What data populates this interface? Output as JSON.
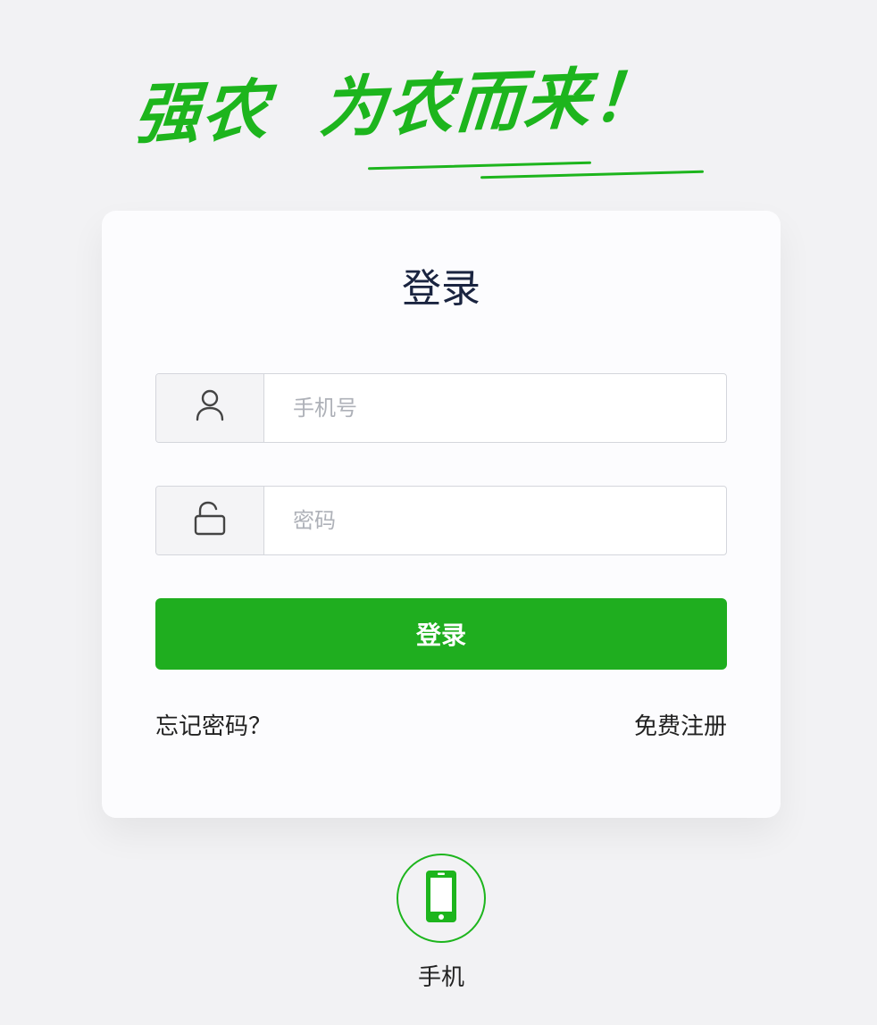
{
  "slogan": {
    "text": "强农  为农而来！"
  },
  "login_card": {
    "title": "登录",
    "phone_field": {
      "placeholder": "手机号",
      "value": "",
      "icon": "user-icon"
    },
    "password_field": {
      "placeholder": "密码",
      "value": "",
      "icon": "unlock-icon"
    },
    "login_button": "登录",
    "forgot_password": "忘记密码？",
    "register": "免费注册"
  },
  "alt_login": {
    "icon": "mobile-phone-icon",
    "label": "手机"
  },
  "colors": {
    "brand_green": "#1db51d",
    "button_green": "#1fae1f",
    "title_navy": "#1a2440",
    "background": "#f2f2f4"
  }
}
